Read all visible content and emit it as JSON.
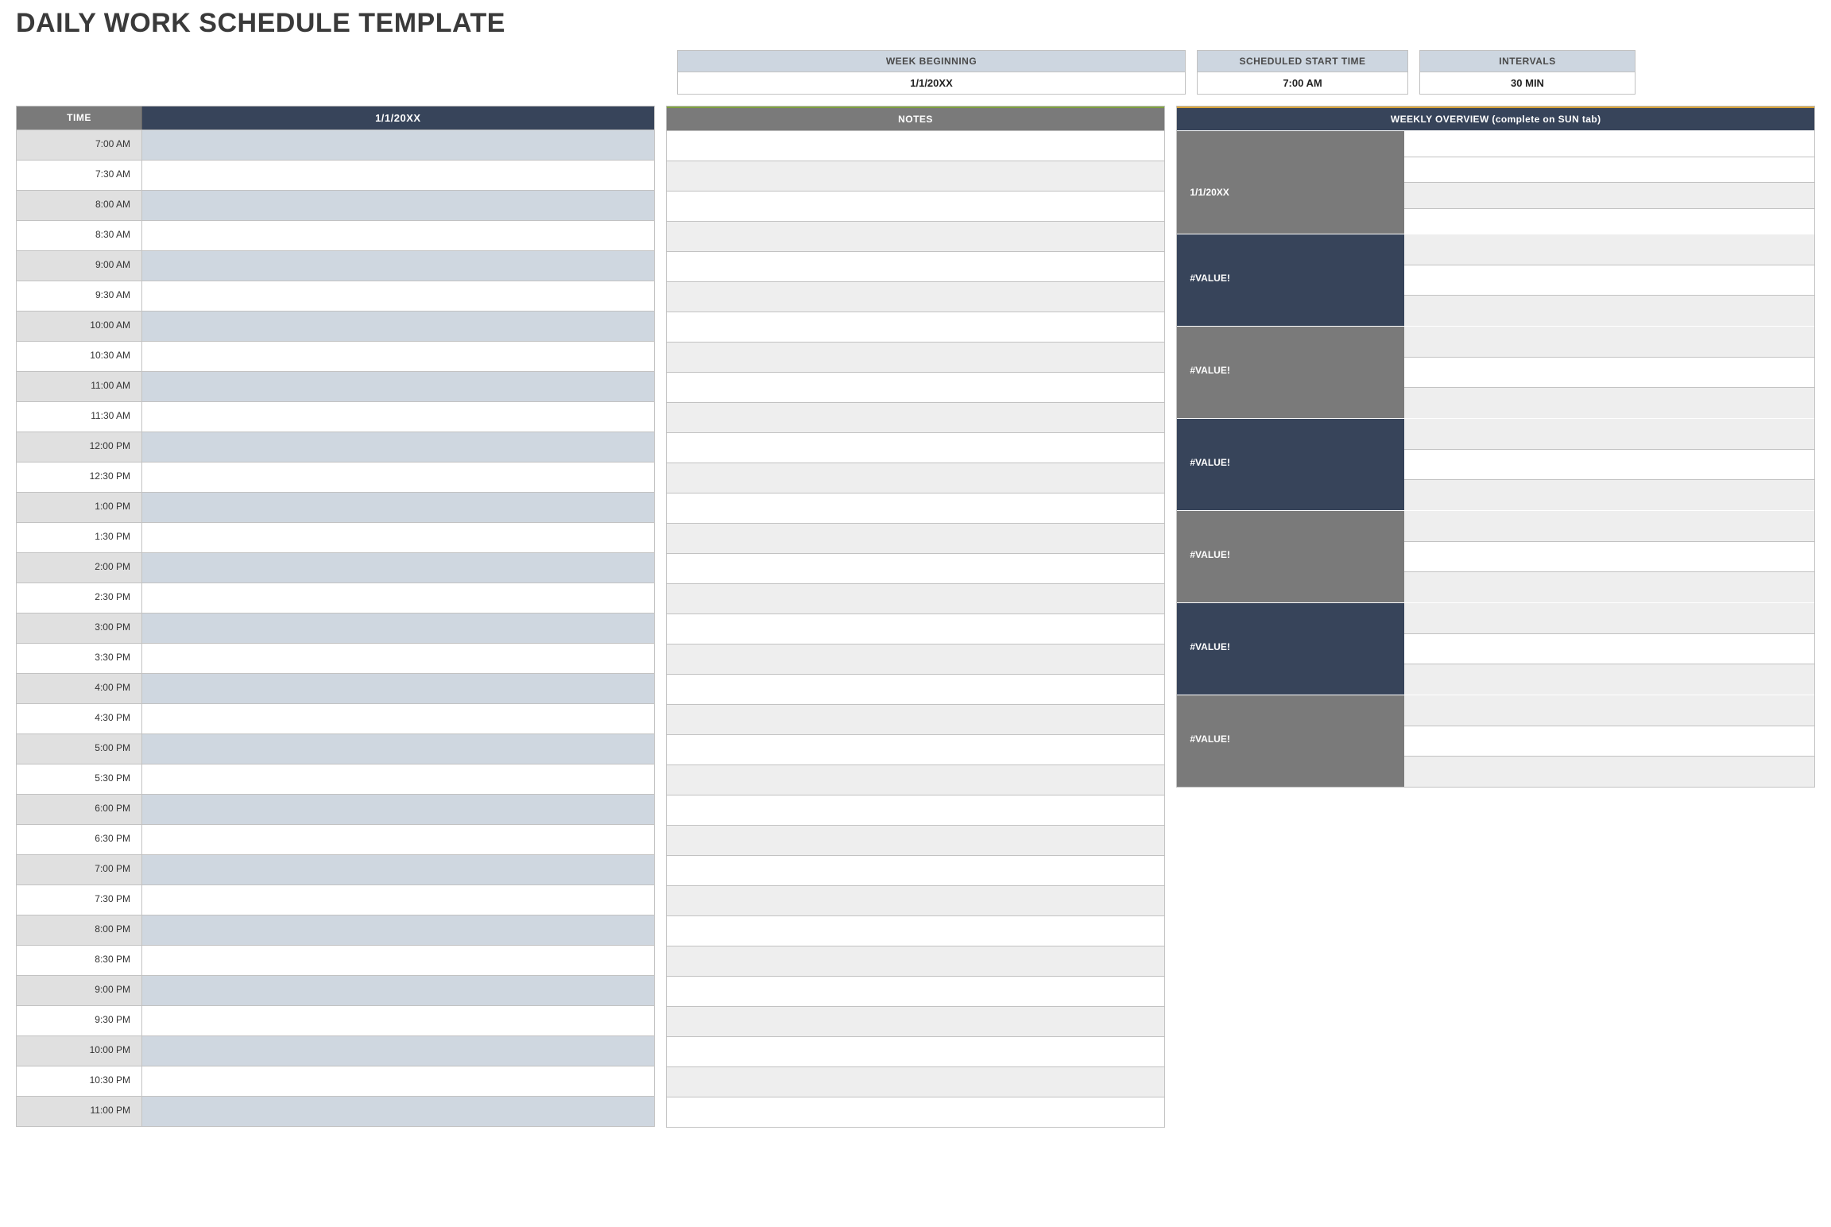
{
  "title": "DAILY WORK SCHEDULE TEMPLATE",
  "top": {
    "week_beginning_label": "WEEK BEGINNING",
    "week_beginning_value": "1/1/20XX",
    "start_time_label": "SCHEDULED START TIME",
    "start_time_value": "7:00 AM",
    "intervals_label": "INTERVALS",
    "intervals_value": "30 MIN"
  },
  "schedule": {
    "time_header": "TIME",
    "date_header": "1/1/20XX",
    "rows": [
      {
        "time": "7:00 AM",
        "task": ""
      },
      {
        "time": "7:30 AM",
        "task": ""
      },
      {
        "time": "8:00 AM",
        "task": ""
      },
      {
        "time": "8:30 AM",
        "task": ""
      },
      {
        "time": "9:00 AM",
        "task": ""
      },
      {
        "time": "9:30 AM",
        "task": ""
      },
      {
        "time": "10:00 AM",
        "task": ""
      },
      {
        "time": "10:30 AM",
        "task": ""
      },
      {
        "time": "11:00 AM",
        "task": ""
      },
      {
        "time": "11:30 AM",
        "task": ""
      },
      {
        "time": "12:00 PM",
        "task": ""
      },
      {
        "time": "12:30 PM",
        "task": ""
      },
      {
        "time": "1:00 PM",
        "task": ""
      },
      {
        "time": "1:30 PM",
        "task": ""
      },
      {
        "time": "2:00 PM",
        "task": ""
      },
      {
        "time": "2:30 PM",
        "task": ""
      },
      {
        "time": "3:00 PM",
        "task": ""
      },
      {
        "time": "3:30 PM",
        "task": ""
      },
      {
        "time": "4:00 PM",
        "task": ""
      },
      {
        "time": "4:30 PM",
        "task": ""
      },
      {
        "time": "5:00 PM",
        "task": ""
      },
      {
        "time": "5:30 PM",
        "task": ""
      },
      {
        "time": "6:00 PM",
        "task": ""
      },
      {
        "time": "6:30 PM",
        "task": ""
      },
      {
        "time": "7:00 PM",
        "task": ""
      },
      {
        "time": "7:30 PM",
        "task": ""
      },
      {
        "time": "8:00 PM",
        "task": ""
      },
      {
        "time": "8:30 PM",
        "task": ""
      },
      {
        "time": "9:00 PM",
        "task": ""
      },
      {
        "time": "9:30 PM",
        "task": ""
      },
      {
        "time": "10:00 PM",
        "task": ""
      },
      {
        "time": "10:30 PM",
        "task": ""
      },
      {
        "time": "11:00 PM",
        "task": ""
      }
    ]
  },
  "notes": {
    "header": "NOTES",
    "rows": [
      "",
      "",
      "",
      "",
      "",
      "",
      "",
      "",
      "",
      "",
      "",
      "",
      "",
      "",
      "",
      "",
      "",
      "",
      "",
      "",
      "",
      "",
      "",
      "",
      "",
      "",
      "",
      "",
      "",
      "",
      "",
      "",
      ""
    ]
  },
  "overview": {
    "header": "WEEKLY OVERVIEW (complete on SUN tab)",
    "days": [
      {
        "label": "1/1/20XX",
        "tone": "gray"
      },
      {
        "label": "#VALUE!",
        "tone": "navy"
      },
      {
        "label": "#VALUE!",
        "tone": "gray"
      },
      {
        "label": "#VALUE!",
        "tone": "navy"
      },
      {
        "label": "#VALUE!",
        "tone": "gray"
      },
      {
        "label": "#VALUE!",
        "tone": "navy"
      },
      {
        "label": "#VALUE!",
        "tone": "gray"
      }
    ]
  }
}
